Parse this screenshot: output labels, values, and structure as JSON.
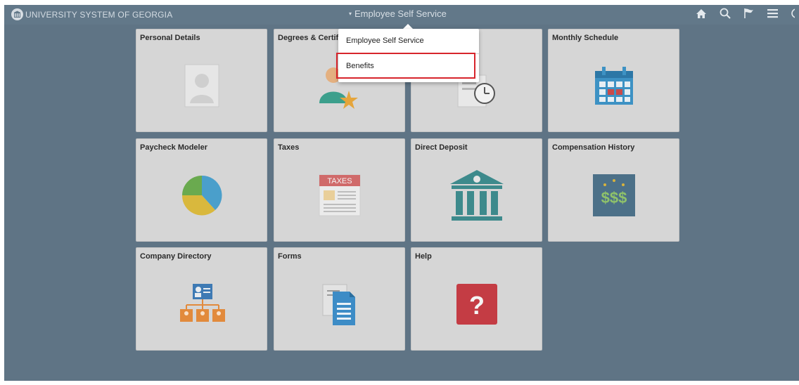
{
  "header": {
    "org_name": "UNIVERSITY SYSTEM OF GEORGIA",
    "title": "Employee Self Service",
    "title_caret": "▾",
    "nav_icons": [
      "home-icon",
      "search-icon",
      "flag-icon",
      "menu-icon"
    ]
  },
  "dropdown": {
    "items": [
      {
        "label": "Employee Self Service"
      },
      {
        "label": "Benefits"
      }
    ],
    "highlight_color": "#d7252c"
  },
  "tiles": [
    {
      "title": "Personal Details",
      "icon": "person-placeholder-icon"
    },
    {
      "title": "Degrees & Certifi",
      "icon": "degree-award-icon"
    },
    {
      "title": "",
      "icon": "timesheet-clock-icon"
    },
    {
      "title": "Monthly Schedule",
      "icon": "calendar-icon"
    },
    {
      "title": "Paycheck Modeler",
      "icon": "pie-chart-icon"
    },
    {
      "title": "Taxes",
      "icon": "taxes-form-icon",
      "badge": "TAXES"
    },
    {
      "title": "Direct Deposit",
      "icon": "bank-icon"
    },
    {
      "title": "Compensation History",
      "icon": "money-history-icon",
      "badge": "$$$"
    },
    {
      "title": "Company Directory",
      "icon": "org-chart-icon"
    },
    {
      "title": "Forms",
      "icon": "forms-icon"
    },
    {
      "title": "Help",
      "icon": "help-icon",
      "badge": "?"
    }
  ],
  "colors": {
    "background": "#5f7485",
    "tile_background": "#d6d6d6",
    "topbar": "#627889"
  }
}
